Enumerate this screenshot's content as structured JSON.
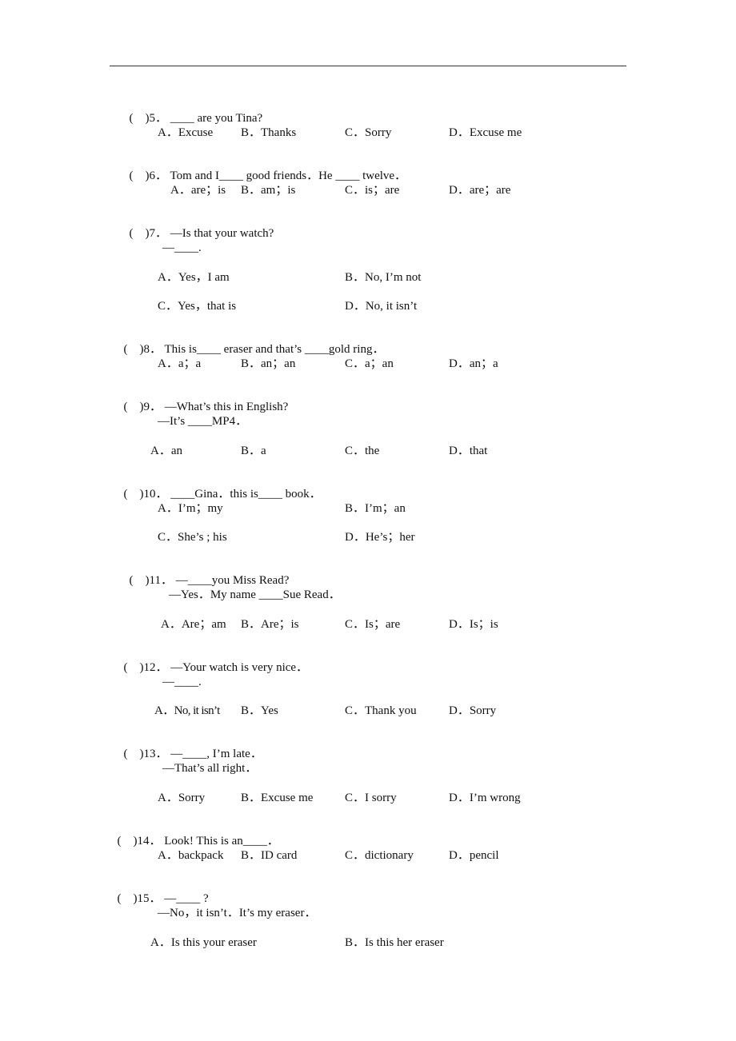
{
  "questions": [
    {
      "paren": "(    )",
      "number": "5．",
      "stem": "____ are you Tina?",
      "reply": null,
      "options": [
        "A．Excuse",
        "B．Thanks",
        "C．Sorry",
        "D．Excuse me"
      ]
    },
    {
      "paren": "(    )",
      "number": "6．",
      "stem": "Tom and I____ good friends．He ____ twelve．",
      "reply": null,
      "options": [
        "A．are；is",
        "B．am；is",
        "C．is；are",
        "D．are；are"
      ]
    },
    {
      "paren": "(    )",
      "number": "7．",
      "stem": "—Is that your watch?",
      "reply": "—____.",
      "options": [
        "A．Yes，I am",
        "B．No, I’m not",
        "C．Yes，that is",
        "D．No, it isn’t"
      ]
    },
    {
      "paren": "(    )",
      "number": "8．",
      "stem": "This is____ eraser and that’s ____gold ring．",
      "reply": null,
      "options": [
        "A．a；a",
        "B．an；an",
        "C．a；an",
        "D．an；a"
      ]
    },
    {
      "paren": "(    )",
      "number": "9．",
      "stem": "—What’s this in English?",
      "reply": "—It’s ____MP4．",
      "options": [
        "A．an",
        "B．a",
        "C．the",
        "D．that"
      ]
    },
    {
      "paren": "(    )",
      "number": "10．",
      "stem": "____Gina．this is____ book．",
      "reply": null,
      "options": [
        "A．I’m；my",
        "B．I’m；an",
        "C．She’s ; his",
        "D．He’s；her"
      ]
    },
    {
      "paren": "(    )",
      "number": "11．",
      "stem": "—____you Miss Read?",
      "reply": "—Yes．My name ____Sue Read．",
      "options": [
        "A．Are；am",
        "B．Are；is",
        "C．Is；are",
        "D．Is；is"
      ]
    },
    {
      "paren": "(    )",
      "number": "12．",
      "stem": "—Your watch is very nice．",
      "reply": "—____.",
      "options": [
        "A．No, it isn’t",
        "B．Yes",
        "C．Thank you",
        "D．Sorry"
      ]
    },
    {
      "paren": "(    )",
      "number": "13．",
      "stem": "—____, I’m late．",
      "reply": "—That’s all right．",
      "options": [
        "A．Sorry",
        "B．Excuse me",
        "C．I sorry",
        "D．I’m wrong"
      ]
    },
    {
      "paren": "(    )",
      "number": "14．",
      "stem": "Look! This is an____．",
      "reply": null,
      "options": [
        "A．backpack",
        "B．ID card",
        "C．dictionary",
        "D．pencil"
      ]
    },
    {
      "paren": "(    )",
      "number": "15．",
      "stem": "—____ ?",
      "reply": "—No，it isn’t．It’s my eraser．",
      "options": [
        "A．Is this your eraser",
        "B．Is this her eraser"
      ]
    }
  ]
}
